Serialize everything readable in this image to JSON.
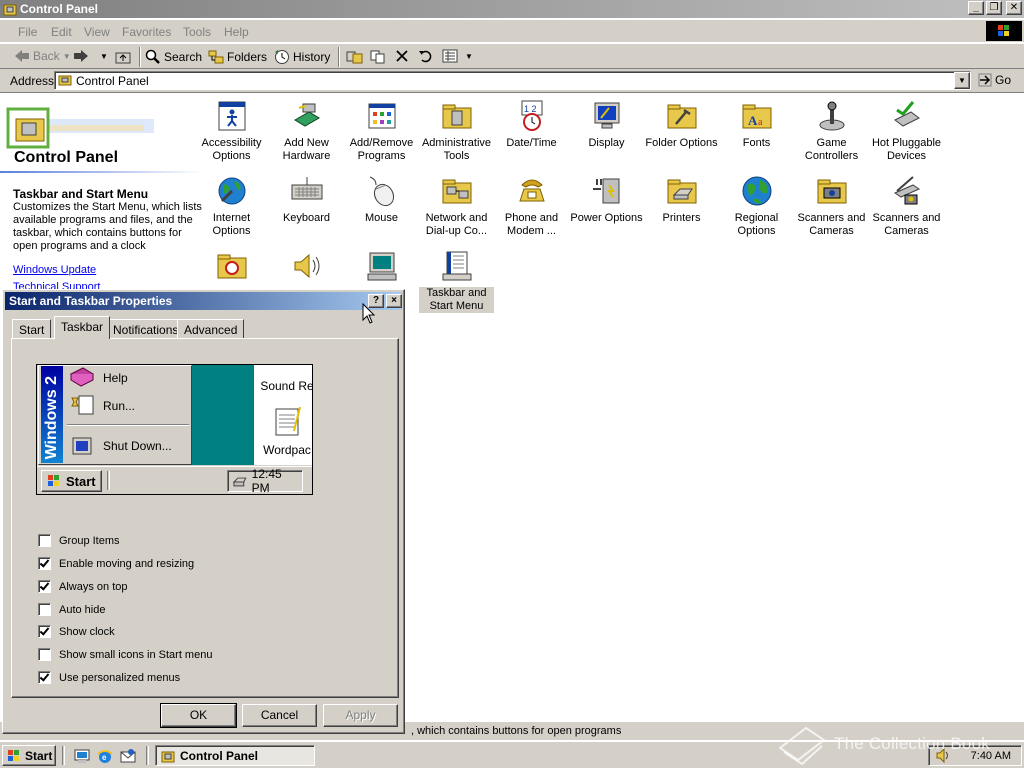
{
  "window": {
    "title": "Control Panel"
  },
  "menu": [
    "File",
    "Edit",
    "View",
    "Favorites",
    "Tools",
    "Help"
  ],
  "toolbar": {
    "back": "Back",
    "search": "Search",
    "folders": "Folders",
    "history": "History"
  },
  "address": {
    "label": "Address",
    "value": "Control Panel",
    "go": "Go"
  },
  "left_panel": {
    "header": "Control Panel",
    "selected_title": "Taskbar and Start Menu",
    "selected_desc": "Customizes the Start Menu, which lists available programs and files, and the taskbar, which contains buttons for open programs and a clock",
    "link_update": "Windows Update",
    "link_support": "Technical Support"
  },
  "icons": [
    {
      "label": "Accessibility Options",
      "icon": "accessibility-icon"
    },
    {
      "label": "Add New Hardware",
      "icon": "add-hardware-icon"
    },
    {
      "label": "Add/Remove Programs",
      "icon": "add-remove-programs-icon"
    },
    {
      "label": "Administrative Tools",
      "icon": "admin-tools-icon"
    },
    {
      "label": "Date/Time",
      "icon": "date-time-icon"
    },
    {
      "label": "Display",
      "icon": "display-icon"
    },
    {
      "label": "Folder Options",
      "icon": "folder-options-icon"
    },
    {
      "label": "Fonts",
      "icon": "fonts-icon"
    },
    {
      "label": "Game Controllers",
      "icon": "game-controllers-icon"
    },
    {
      "label": "Hot Pluggable Devices",
      "icon": "hot-pluggable-icon"
    },
    {
      "label": "Internet Options",
      "icon": "internet-options-icon"
    },
    {
      "label": "Keyboard",
      "icon": "keyboard-icon"
    },
    {
      "label": "Mouse",
      "icon": "mouse-icon"
    },
    {
      "label": "Network and Dial-up Co...",
      "icon": "network-icon"
    },
    {
      "label": "Phone and Modem ...",
      "icon": "phone-modem-icon"
    },
    {
      "label": "Power Options",
      "icon": "power-options-icon"
    },
    {
      "label": "Printers",
      "icon": "printers-icon"
    },
    {
      "label": "Regional Options",
      "icon": "regional-options-icon"
    },
    {
      "label": "Scanners and Cameras",
      "icon": "scanners-icon"
    },
    {
      "label": "Scanners and Cameras",
      "icon": "scanners-icon"
    },
    {
      "label": "",
      "icon": "scheduled-tasks-icon"
    },
    {
      "label": "",
      "icon": "sounds-icon"
    },
    {
      "label": "",
      "icon": "system-icon"
    },
    {
      "label": "Taskbar and Start Menu",
      "icon": "taskbar-icon"
    }
  ],
  "status": {
    "text": ", which contains buttons for open programs"
  },
  "taskbar": {
    "start": "Start",
    "task_label": "Control Panel",
    "time": "7:40 AM"
  },
  "watermark": "The Collection Book",
  "dialog": {
    "title": "Start and Taskbar Properties",
    "help_btn": "?",
    "close_btn": "×",
    "tabs": [
      "Start",
      "Taskbar",
      "Notifications",
      "Advanced"
    ],
    "active_tab": "Taskbar",
    "preview": {
      "stripe_text": "Windows 2",
      "menu_items": [
        "Help",
        "Run...",
        "Shut Down..."
      ],
      "desktop_icons": [
        "Sound Re",
        "Wordpac"
      ],
      "start": "Start",
      "time": "12:45 PM"
    },
    "checkboxes": [
      {
        "label": "Group Items",
        "checked": false
      },
      {
        "label": "Enable moving and resizing",
        "checked": true
      },
      {
        "label": "Always on top",
        "checked": true
      },
      {
        "label": "Auto hide",
        "checked": false
      },
      {
        "label": "Show clock",
        "checked": true
      },
      {
        "label": "Show small icons in Start menu",
        "checked": false
      },
      {
        "label": "Use personalized menus",
        "checked": true
      }
    ],
    "ok": "OK",
    "cancel": "Cancel",
    "apply": "Apply"
  }
}
